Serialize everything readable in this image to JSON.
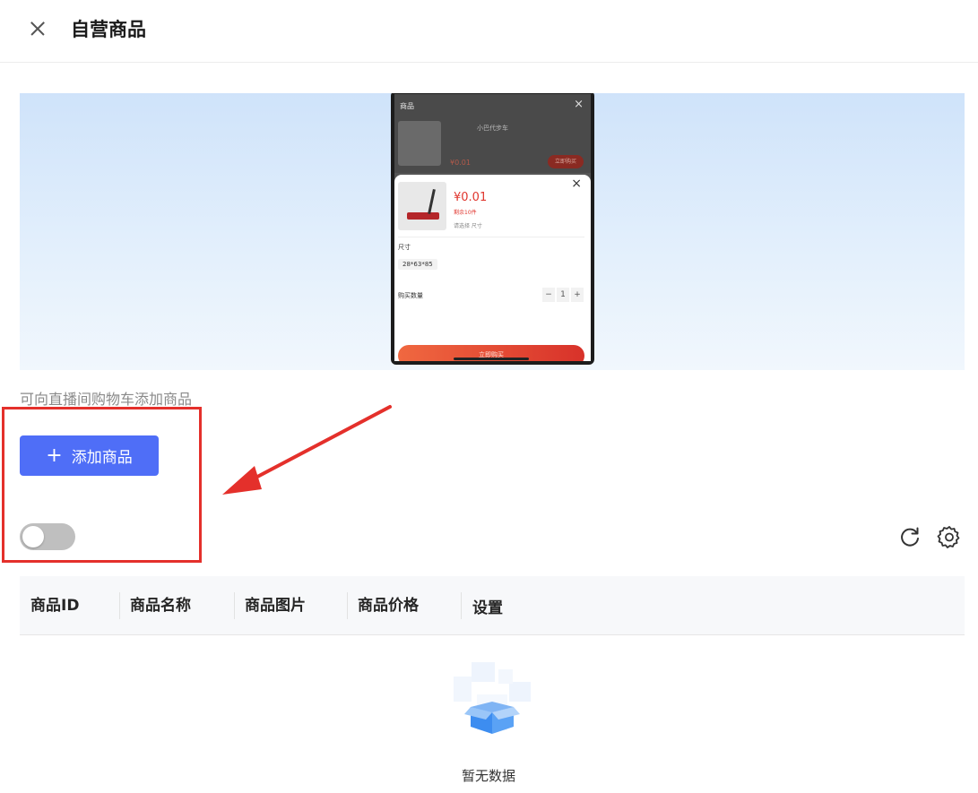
{
  "header": {
    "title": "自营商品"
  },
  "preview": {
    "top_title": "商品",
    "product_name": "小巴代步车",
    "dim_price": "¥0.01",
    "dim_button": "立即购买",
    "price": "¥0.01",
    "stock": "剩余10件",
    "select_hint": "请选择 尺寸",
    "size_label": "尺寸",
    "size_option": "28*63*85",
    "qty_label": "购买数量",
    "qty_minus": "−",
    "qty_value": "1",
    "qty_plus": "+",
    "buy_button": "立即购买"
  },
  "description": "可向直播间购物车添加商品",
  "add_button": {
    "icon": "plus-icon",
    "label": "添加商品"
  },
  "toggle": {
    "on": false
  },
  "toolbar": {
    "icons": [
      "refresh-icon",
      "gear-icon"
    ]
  },
  "table": {
    "columns": [
      "商品ID",
      "商品名称",
      "商品图片",
      "商品价格",
      "设置"
    ]
  },
  "empty_state": {
    "text": "暂无数据"
  },
  "colors": {
    "primary": "#4f6ef7",
    "highlight": "#e4302b",
    "price_red": "#e0362e"
  }
}
